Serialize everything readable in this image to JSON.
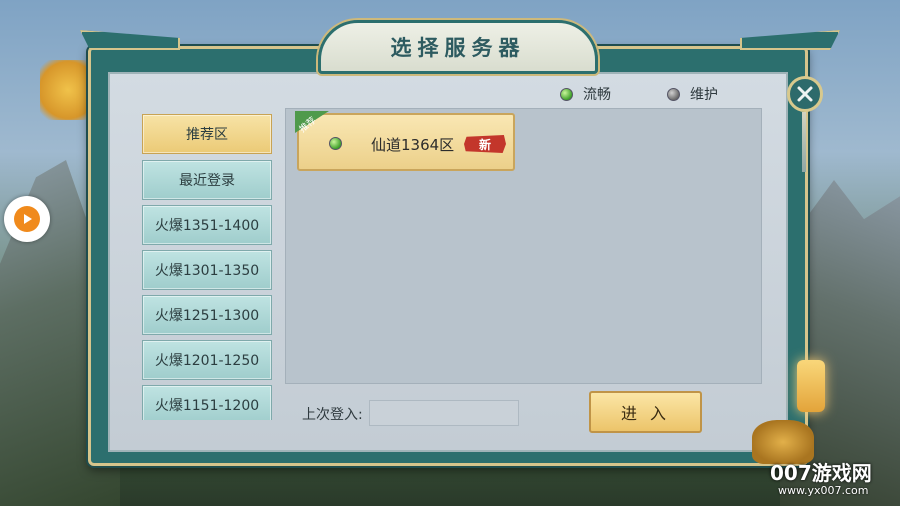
{
  "title": "选择服务器",
  "legend": {
    "good_label": "流畅",
    "maint_label": "维护"
  },
  "sidebar": {
    "items": [
      {
        "label": "推荐区",
        "active": true
      },
      {
        "label": "最近登录",
        "active": false
      },
      {
        "label": "火爆1351-1400",
        "active": false
      },
      {
        "label": "火爆1301-1350",
        "active": false
      },
      {
        "label": "火爆1251-1300",
        "active": false
      },
      {
        "label": "火爆1201-1250",
        "active": false
      },
      {
        "label": "火爆1151-1200",
        "active": false
      }
    ]
  },
  "servers": [
    {
      "name": "仙道1364区",
      "status": "good",
      "badge": "新",
      "ribbon": "推荐"
    }
  ],
  "last_login": {
    "label": "上次登入:",
    "value": ""
  },
  "enter_button": "进 入",
  "watermark": {
    "main": "007游戏网",
    "sub": "www.yx007.com"
  },
  "colors": {
    "accent_gold": "#ebca76",
    "frame_teal": "#2c6f6e",
    "status_green": "#3fa02a",
    "status_gray": "#6a6a6a",
    "badge_red": "#c3362b"
  },
  "icons": {
    "close": "close-icon",
    "float": "play-icon"
  }
}
